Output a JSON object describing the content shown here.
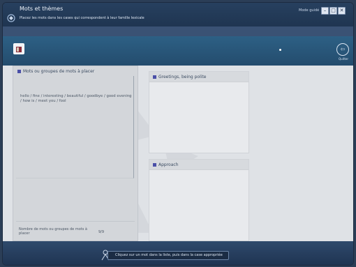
{
  "window": {
    "title": "Mots et thèmes",
    "instruction": "Placez les mots dans les cases qui correspondent à leur famille lexicale",
    "mode_label": "Mode guidé",
    "minimize_label": "–",
    "maximize_label": "□",
    "close_label": "✕"
  },
  "toolbar": {
    "exit_glyph": "⇦",
    "exit_label": "Quitter"
  },
  "left_panel": {
    "title": "Mots ou groupes de mots à placer",
    "words": "hello / fine / interesting / beautiful / goodbye / good evening / how is / meet you / fool",
    "count_label": "Nombre de mots ou groupes de mots à placer",
    "count_value": "9/9"
  },
  "families": [
    {
      "title": "Greetings, being polite"
    },
    {
      "title": "Approach"
    }
  ],
  "bottom": {
    "feedback": "Cliquez sur un mot dans la liste, puis dans la case appropriée"
  },
  "colors": {
    "titlebar": "#1f3551",
    "toolbar": "#2d6085",
    "content_bg": "#dfe2e6",
    "accent_square": "#4a4fa8"
  }
}
